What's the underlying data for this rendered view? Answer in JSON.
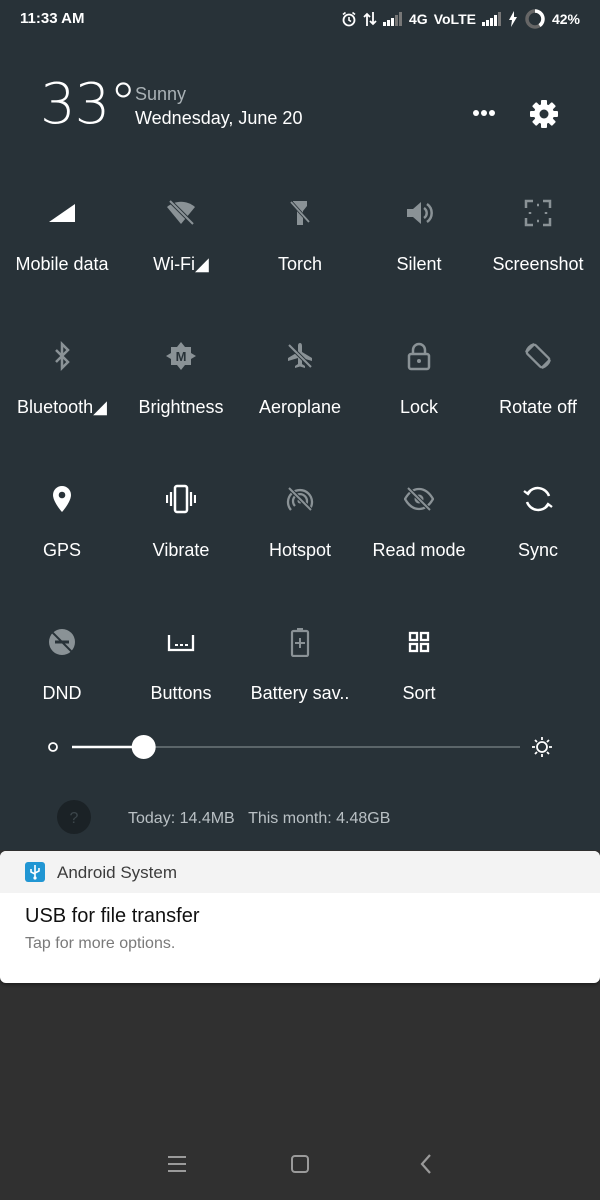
{
  "status_bar": {
    "time": "11:33 AM",
    "network_type": "4G",
    "volte": "VoLTE",
    "battery": "42%"
  },
  "weather": {
    "temperature": "33°",
    "condition": "Sunny",
    "date": "Wednesday, June 20"
  },
  "tiles": [
    {
      "label": "Mobile data",
      "icon": "mobile-data-icon",
      "active": true
    },
    {
      "label": "Wi-Fi◢",
      "icon": "wifi-off-icon",
      "active": false
    },
    {
      "label": "Torch",
      "icon": "torch-icon",
      "active": false
    },
    {
      "label": "Silent",
      "icon": "volume-icon",
      "active": false
    },
    {
      "label": "Screenshot",
      "icon": "screenshot-icon",
      "active": false
    },
    {
      "label": "Bluetooth◢",
      "icon": "bluetooth-icon",
      "active": false
    },
    {
      "label": "Brightness",
      "icon": "brightness-auto-icon",
      "active": false
    },
    {
      "label": "Aeroplane",
      "icon": "airplane-icon",
      "active": false
    },
    {
      "label": "Lock",
      "icon": "lock-icon",
      "active": false
    },
    {
      "label": "Rotate off",
      "icon": "rotate-icon",
      "active": false
    },
    {
      "label": "GPS",
      "icon": "location-icon",
      "active": true
    },
    {
      "label": "Vibrate",
      "icon": "vibrate-icon",
      "active": true
    },
    {
      "label": "Hotspot",
      "icon": "hotspot-off-icon",
      "active": false
    },
    {
      "label": "Read mode",
      "icon": "eye-off-icon",
      "active": false
    },
    {
      "label": "Sync",
      "icon": "sync-icon",
      "active": true
    },
    {
      "label": "DND",
      "icon": "dnd-icon",
      "active": false
    },
    {
      "label": "Buttons",
      "icon": "buttons-icon",
      "active": true
    },
    {
      "label": "Battery sav..",
      "icon": "battery-saver-icon",
      "active": false
    },
    {
      "label": "Sort",
      "icon": "sort-grid-icon",
      "active": true
    }
  ],
  "brightness": {
    "level": 0.16
  },
  "data_usage": {
    "today": "Today: 14.4MB",
    "month": "This month: 4.48GB"
  },
  "notification": {
    "app": "Android System",
    "title": "USB for file transfer",
    "subtitle": "Tap for more options."
  },
  "colors": {
    "shade_bg": "#283238",
    "active_icon": "#ffffff",
    "inactive_icon": "#8a9296",
    "usb_icon_bg": "#2196d3"
  }
}
